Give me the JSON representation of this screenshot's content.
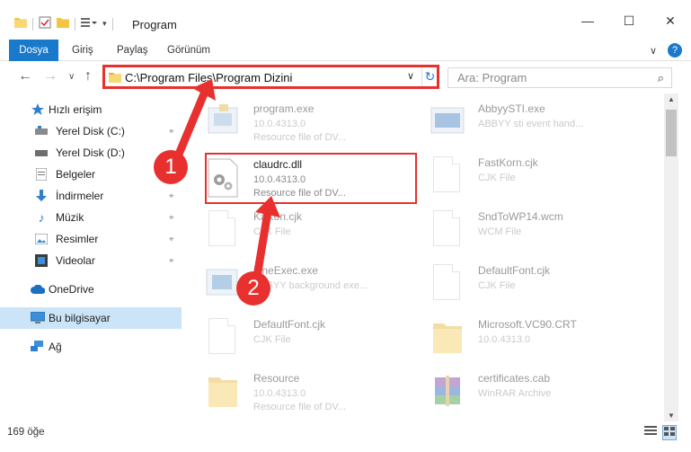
{
  "window": {
    "title": "Program",
    "minimize": "—",
    "maximize": "☐",
    "close": "✕"
  },
  "ribbon": {
    "tabs": [
      "Dosya",
      "Giriş",
      "Paylaş",
      "Görünüm"
    ],
    "expand": "∨",
    "help": "?"
  },
  "address": {
    "path": "C:\\Program Files\\Program Dizini",
    "chevron": "∨",
    "refresh": "↻"
  },
  "search": {
    "placeholder": "Ara: Program",
    "icon": "⌕"
  },
  "nav": {
    "back": "←",
    "forward": "→",
    "recent": "∨",
    "up": "↑"
  },
  "sidebar": {
    "items": [
      {
        "label": "Hızlı erişim",
        "icon": "star-icon"
      },
      {
        "label": "Yerel Disk (C:)",
        "icon": "drive-icon",
        "pinned": true
      },
      {
        "label": "Yerel Disk (D:)",
        "icon": "drive-icon"
      },
      {
        "label": "Belgeler",
        "icon": "documents-icon",
        "pinned": true
      },
      {
        "label": "İndirmeler",
        "icon": "download-icon",
        "pinned": true
      },
      {
        "label": "Müzik",
        "icon": "music-icon",
        "pinned": true
      },
      {
        "label": "Resimler",
        "icon": "pictures-icon",
        "pinned": true
      },
      {
        "label": "Videolar",
        "icon": "video-icon",
        "pinned": true
      },
      {
        "label": "OneDrive",
        "icon": "cloud-icon"
      },
      {
        "label": "Bu bilgisayar",
        "icon": "computer-icon"
      },
      {
        "label": "Ağ",
        "icon": "network-icon"
      }
    ],
    "pin_glyph": "📌"
  },
  "files": {
    "left": [
      {
        "name": "program.exe",
        "l2": "10.0.4313.0",
        "l3": "Resource file of DV..."
      },
      {
        "name": "claudrc.dll",
        "l2": "10.0.4313.0",
        "l3": "Resource file of DV..."
      },
      {
        "name": "KaKon.cjk",
        "l2": "CJK File",
        "l3": ""
      },
      {
        "name": "LineExec.exe",
        "l2": "ABBYY background exe...",
        "l3": ""
      },
      {
        "name": "DefaultFont.cjk",
        "l2": "CJK File",
        "l3": ""
      },
      {
        "name": "Resource",
        "l2": "10.0.4313.0",
        "l3": "Resource file of DV..."
      }
    ],
    "right": [
      {
        "name": "AbbyySTI.exe",
        "l2": "ABBYY sti event hand...",
        "l3": ""
      },
      {
        "name": "FastKorn.cjk",
        "l2": "CJK File",
        "l3": ""
      },
      {
        "name": "SndToWP14.wcm",
        "l2": "WCM File",
        "l3": ""
      },
      {
        "name": "DefaultFont.cjk",
        "l2": "CJK File",
        "l3": ""
      },
      {
        "name": "Microsoft.VC90.CRT",
        "l2": "10.0.4313.0",
        "l3": ""
      },
      {
        "name": "certificates.cab",
        "l2": "WinRAR Archive",
        "l3": ""
      }
    ]
  },
  "annotations": {
    "step1": "1",
    "step2": "2"
  },
  "status": {
    "count": "169 öğe"
  },
  "colors": {
    "accent": "#1979ca",
    "annotation": "#e8312f",
    "selected": "#cce4f7"
  }
}
